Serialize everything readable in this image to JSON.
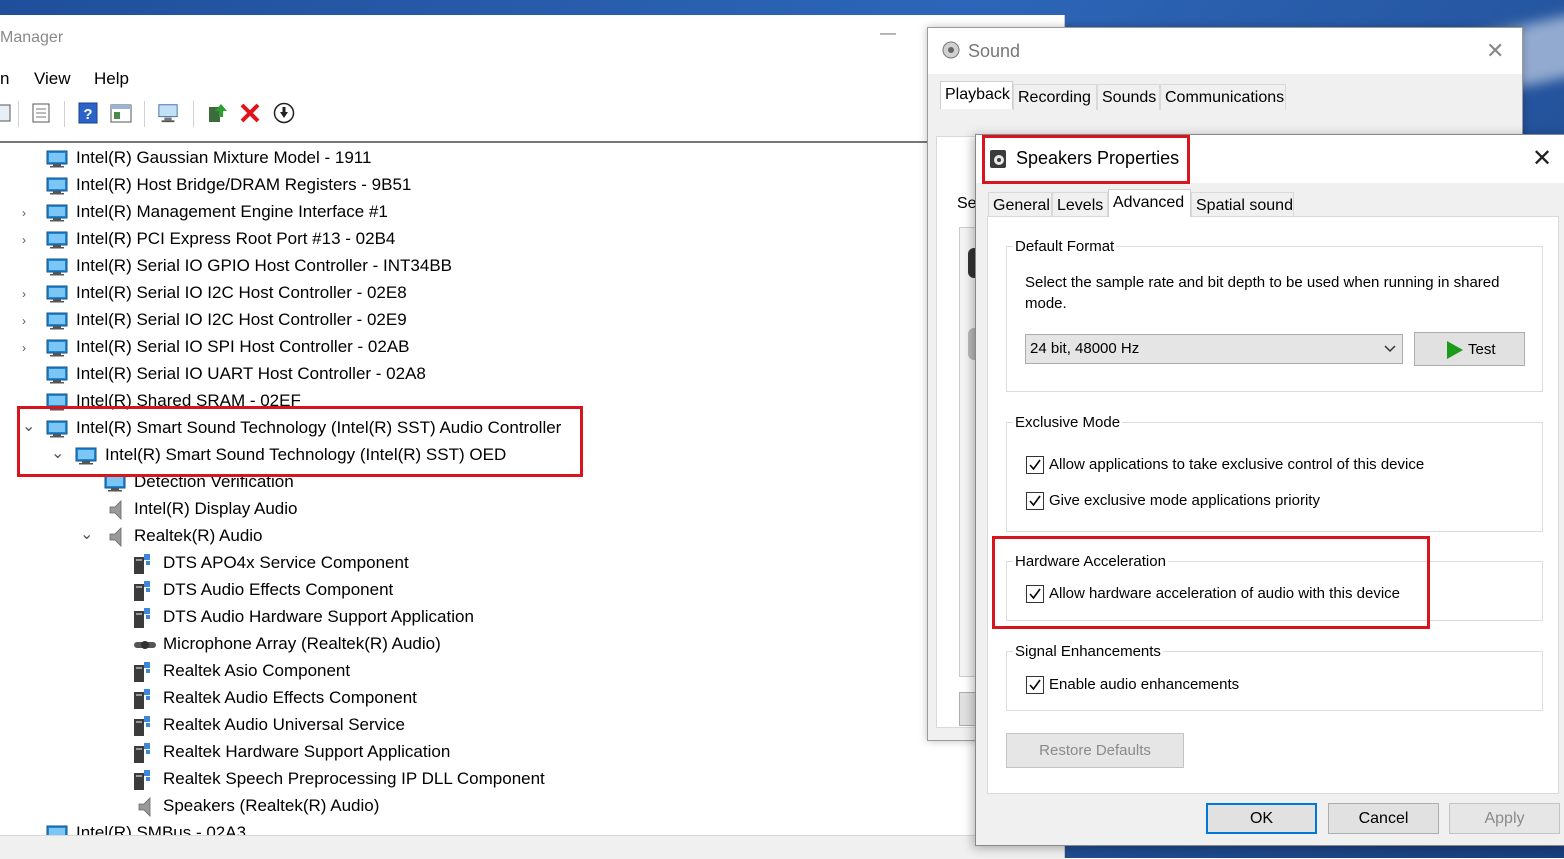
{
  "device_manager": {
    "title_partial": "Manager",
    "minimize_glyph": "—",
    "menu": [
      "n",
      "View",
      "Help"
    ],
    "tree_rows": [
      {
        "label": "Intel(R) Gaussian Mixture Model - 1911",
        "expander": "",
        "icon": "monitor-icon"
      },
      {
        "label": "Intel(R) Host Bridge/DRAM Registers - 9B51",
        "expander": "",
        "icon": "monitor-icon"
      },
      {
        "label": "Intel(R) Management Engine Interface #1",
        "expander": "›",
        "icon": "monitor-icon"
      },
      {
        "label": "Intel(R) PCI Express Root Port #13 - 02B4",
        "expander": "›",
        "icon": "monitor-icon"
      },
      {
        "label": "Intel(R) Serial IO GPIO Host Controller - INT34BB",
        "expander": "",
        "icon": "monitor-icon"
      },
      {
        "label": "Intel(R) Serial IO I2C Host Controller - 02E8",
        "expander": "›",
        "icon": "monitor-icon"
      },
      {
        "label": "Intel(R) Serial IO I2C Host Controller - 02E9",
        "expander": "›",
        "icon": "monitor-icon"
      },
      {
        "label": "Intel(R) Serial IO SPI Host Controller - 02AB",
        "expander": "›",
        "icon": "monitor-icon"
      },
      {
        "label": "Intel(R) Serial IO UART Host Controller - 02A8",
        "expander": "",
        "icon": "monitor-icon"
      },
      {
        "label": "Intel(R) Shared SRAM - 02EF",
        "expander": "",
        "icon": "monitor-icon"
      },
      {
        "label": "Intel(R) Smart Sound Technology (Intel(R) SST) Audio Controller",
        "expander": "⌄",
        "icon": "monitor-icon"
      },
      {
        "label": "Intel(R) Smart Sound Technology (Intel(R) SST) OED",
        "expander": "⌄",
        "icon": "monitor-icon"
      },
      {
        "label": "Detection Verification",
        "expander": "",
        "icon": "monitor-icon"
      },
      {
        "label": "Intel(R) Display Audio",
        "expander": "",
        "icon": "speaker-icon"
      },
      {
        "label": "Realtek(R) Audio",
        "expander": "⌄",
        "icon": "speaker-icon"
      },
      {
        "label": "DTS APO4x Service Component",
        "expander": "",
        "icon": "component-icon"
      },
      {
        "label": "DTS Audio Effects Component",
        "expander": "",
        "icon": "component-icon"
      },
      {
        "label": "DTS Audio Hardware Support Application",
        "expander": "",
        "icon": "component-icon"
      },
      {
        "label": "Microphone Array (Realtek(R) Audio)",
        "expander": "",
        "icon": "microphone-icon"
      },
      {
        "label": "Realtek Asio Component",
        "expander": "",
        "icon": "component-icon"
      },
      {
        "label": "Realtek Audio Effects Component",
        "expander": "",
        "icon": "component-icon"
      },
      {
        "label": "Realtek Audio Universal Service",
        "expander": "",
        "icon": "component-icon"
      },
      {
        "label": "Realtek Hardware Support Application",
        "expander": "",
        "icon": "component-icon"
      },
      {
        "label": "Realtek Speech Preprocessing IP DLL Component",
        "expander": "",
        "icon": "component-icon"
      },
      {
        "label": "Speakers (Realtek(R) Audio)",
        "expander": "",
        "icon": "speaker-icon"
      },
      {
        "label": "Intel(R) SMBus - 02A3",
        "expander": "",
        "icon": "monitor-icon"
      }
    ]
  },
  "sound": {
    "title": "Sound",
    "close_glyph": "✕",
    "tabs": [
      "Playback",
      "Recording",
      "Sounds",
      "Communications"
    ],
    "active_tab": "Playback",
    "select_text_partial": "Se"
  },
  "speakers": {
    "title": "Speakers Properties",
    "close_glyph": "✕",
    "tabs": [
      "General",
      "Levels",
      "Advanced",
      "Spatial sound"
    ],
    "active_tab": "Advanced",
    "default_format": {
      "title": "Default Format",
      "description": "Select the sample rate and bit depth to be used when running in shared mode.",
      "selected": "24 bit, 48000 Hz",
      "test_label": "Test"
    },
    "exclusive_mode": {
      "title": "Exclusive Mode",
      "allow_exclusive": "Allow applications to take exclusive control of this device",
      "allow_exclusive_checked": true,
      "priority": "Give exclusive mode applications priority",
      "priority_checked": true
    },
    "hardware_acceleration": {
      "title": "Hardware Acceleration",
      "allow_hw": "Allow hardware acceleration of audio with this device",
      "allow_hw_checked": true
    },
    "signal_enhancements": {
      "title": "Signal Enhancements",
      "enable": "Enable audio enhancements",
      "enable_checked": true
    },
    "restore_defaults": "Restore Defaults",
    "ok": "OK",
    "cancel": "Cancel",
    "apply": "Apply"
  },
  "colors": {
    "highlight_red": "#d8141c",
    "test_arrow_green": "#1a9b1a",
    "default_button_border": "#0078d7"
  }
}
